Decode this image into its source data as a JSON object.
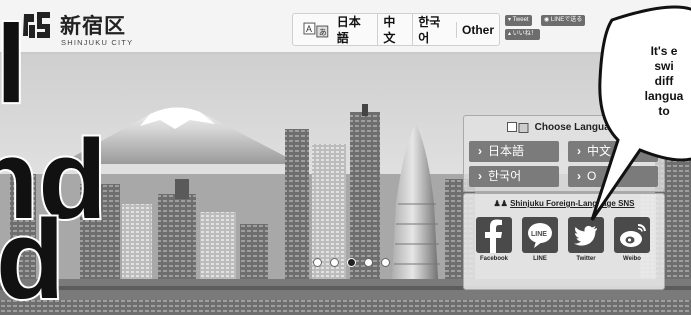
{
  "header": {
    "logo_ja": "新宿区",
    "logo_en": "SHINJUKU CITY",
    "languages": [
      "日本語",
      "中文",
      "한국어",
      "Other"
    ],
    "social": {
      "tweet": "Tweet",
      "line_share": "LINEで送る",
      "fb_like": "いいね！"
    }
  },
  "language_panel": {
    "title": "Choose Language",
    "buttons": [
      "日本語",
      "中文",
      "한국어",
      "O"
    ]
  },
  "sns_panel": {
    "title": "Shinjuku Foreign-Language SNS",
    "items": [
      {
        "label": "Facebook",
        "icon": "facebook-icon"
      },
      {
        "label": "LINE",
        "icon": "line-icon"
      },
      {
        "label": "Twitter",
        "icon": "twitter-icon"
      },
      {
        "label": "Weibo",
        "icon": "weibo-icon"
      }
    ]
  },
  "carousel": {
    "dots": 5,
    "active": 2
  },
  "overlay_text": {
    "line1": "l",
    "line2": "nd",
    "line3": "d"
  },
  "bubble": {
    "line1": "It's e",
    "line2": "swi",
    "line3": "diff",
    "line4": "langua",
    "line5": "to"
  },
  "colors": {
    "header_bg": "#f4f4f4",
    "button_gray": "#7b7b7b",
    "photo_tone": "grayscale"
  }
}
